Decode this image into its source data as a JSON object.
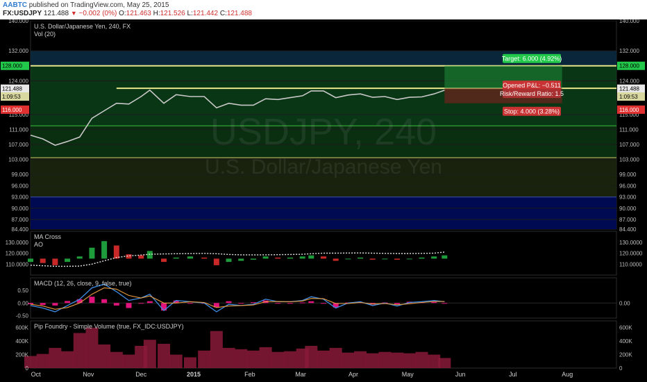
{
  "header": {
    "user": "AABTC",
    "published": "published on TradingView.com, May 25, 2015",
    "symbol": "FX:USDJPY",
    "last": "121.488",
    "change_arrow": "▼",
    "change": "−0.002 (0%)",
    "open_label": "O:",
    "open": "121.463",
    "high_label": "H:",
    "high": "121.526",
    "low_label": "L:",
    "low": "121.442",
    "close_label": "C:",
    "close": "121.488"
  },
  "colors": {
    "background": "#000000",
    "price_line": "#c8c8c8",
    "yellow": "#e8e58a",
    "green_zone": "#0d4d1e",
    "blue_zone": "#000a52",
    "target": "#22c84a",
    "stop": "#c83232",
    "hist_up": "#1e9c3c",
    "hist_down": "#c82828",
    "macd_line": "#3f8ee8",
    "signal_line": "#e89c3f",
    "macd_hist": "#e0147a",
    "volume": "#8a1a3a"
  },
  "chart_data": [
    {
      "type": "line",
      "title": "U.S. Dollar/Japanese Yen, 240, FX",
      "subtitle": "Vol (20)",
      "watermark_symbol": "USDJPY, 240",
      "watermark_name": "U.S. Dollar/Japanese Yen",
      "ylim": [
        84.4,
        140.0
      ],
      "y_ticks": [
        "140.000",
        "132.000",
        "128.000",
        "124.000",
        "121.488",
        "116.000",
        "115.000",
        "111.000",
        "107.000",
        "103.000",
        "99.000",
        "96.000",
        "93.000",
        "90.000",
        "87.000",
        "84.400"
      ],
      "left_price_tags": [
        "128.000",
        "121.488",
        "1:09:53",
        "116.000"
      ],
      "right_price_tags": [
        "128.000",
        "121.488",
        "1:09:53",
        "116.000"
      ],
      "x_ticks": [
        "Oct",
        "Nov",
        "Dec",
        "2015",
        "Feb",
        "Mar",
        "Apr",
        "May",
        "Jun",
        "Jul",
        "Aug"
      ],
      "x": [
        "2014-10-01",
        "2014-10-08",
        "2014-10-15",
        "2014-10-22",
        "2014-10-29",
        "2014-11-05",
        "2014-11-12",
        "2014-11-19",
        "2014-11-26",
        "2014-12-03",
        "2014-12-08",
        "2014-12-16",
        "2014-12-23",
        "2014-12-31",
        "2015-01-08",
        "2015-01-15",
        "2015-01-22",
        "2015-01-29",
        "2015-02-05",
        "2015-02-12",
        "2015-02-19",
        "2015-02-26",
        "2015-03-05",
        "2015-03-10",
        "2015-03-17",
        "2015-03-24",
        "2015-03-31",
        "2015-04-07",
        "2015-04-14",
        "2015-04-21",
        "2015-04-28",
        "2015-05-05",
        "2015-05-12",
        "2015-05-19",
        "2015-05-25"
      ],
      "values": [
        109.5,
        108.5,
        106.8,
        107.8,
        109.0,
        114.0,
        116.0,
        118.0,
        117.8,
        119.8,
        121.5,
        118.0,
        120.3,
        119.8,
        119.8,
        116.8,
        118.0,
        117.5,
        117.5,
        119.2,
        119.0,
        119.5,
        120.0,
        121.3,
        121.3,
        119.5,
        120.2,
        120.5,
        119.6,
        119.8,
        119.0,
        119.6,
        119.7,
        120.5,
        121.488
      ],
      "horizontal_levels": [
        128.0,
        122.0,
        112.0,
        103.5,
        93.0
      ],
      "position": {
        "entry": 122.0,
        "target_price": 128.0,
        "stop_price": 118.0,
        "start": "2015-05-25",
        "end": "2015-07-31",
        "target_label": "Target: 6.000 (4.92%)",
        "pnl_label": "Opened P&L: −0.511",
        "ratio_label": "Risk/Reward Ratio: 1.5",
        "stop_label": "Stop: 4.000 (3.28%)"
      }
    },
    {
      "type": "bar",
      "title": "MA Cross",
      "subtitle": "AO",
      "ylim": [
        100,
        140
      ],
      "y_ticks_left": [
        "130.0000",
        "120.0000",
        "110.0000"
      ],
      "y_ticks_right": [
        "130.0000",
        "120.0000",
        "110.0000"
      ],
      "ma_slow": [
        109.0,
        108.5,
        108.0,
        108.0,
        108.2,
        110.0,
        113.0,
        116.0,
        117.5,
        118.3,
        119.0,
        119.3,
        119.5,
        119.6,
        119.8,
        119.5,
        118.8,
        118.5,
        118.4,
        118.5,
        118.6,
        118.8,
        119.0,
        119.5,
        120.0,
        120.0,
        120.1,
        120.2,
        120.0,
        119.8,
        119.7,
        119.7,
        119.8,
        120.0,
        121.0
      ],
      "ao": [
        -3,
        -4,
        -6,
        -3,
        2,
        10,
        16,
        12,
        4,
        3,
        7,
        -3,
        1,
        2,
        1,
        -6,
        -3,
        -2,
        -1,
        2,
        1,
        1,
        2,
        3,
        2,
        -2,
        0,
        1,
        -1,
        0,
        -1,
        0,
        1,
        2,
        3
      ]
    },
    {
      "type": "line",
      "title": "MACD (12, 26, close, 9, false, true)",
      "ylim": [
        -0.6,
        1.0
      ],
      "y_ticks_left": [
        "0.50",
        "0.00",
        "-0.50"
      ],
      "y_ticks_right": [
        "0.00"
      ],
      "macd": [
        -0.1,
        -0.2,
        -0.35,
        -0.1,
        0.15,
        0.6,
        0.75,
        0.45,
        0.1,
        0.2,
        0.35,
        -0.3,
        0.1,
        0.05,
        0.0,
        -0.35,
        -0.05,
        -0.1,
        -0.05,
        0.15,
        0.05,
        0.05,
        0.1,
        0.25,
        0.15,
        -0.2,
        0.0,
        0.05,
        -0.1,
        0.0,
        -0.12,
        0.02,
        0.05,
        0.1,
        0.05
      ],
      "signal": [
        -0.05,
        -0.12,
        -0.25,
        -0.18,
        0.0,
        0.35,
        0.6,
        0.55,
        0.3,
        0.2,
        0.28,
        0.0,
        0.0,
        0.05,
        0.02,
        -0.18,
        -0.12,
        -0.1,
        -0.08,
        0.05,
        0.06,
        0.05,
        0.08,
        0.18,
        0.17,
        -0.02,
        -0.02,
        0.02,
        -0.04,
        -0.02,
        -0.07,
        -0.03,
        0.02,
        0.06,
        0.06
      ]
    },
    {
      "type": "bar",
      "title": "Pip Foundry - Simple Volume (true, FX_IDC:USDJPY)",
      "ylim": [
        0,
        700000
      ],
      "y_ticks_left": [
        "600K",
        "400K",
        "200K",
        "0"
      ],
      "y_ticks_right": [
        "600K",
        "400K",
        "200K",
        "0"
      ],
      "values": [
        180000,
        210000,
        300000,
        250000,
        520000,
        600000,
        350000,
        240000,
        200000,
        330000,
        420000,
        360000,
        200000,
        160000,
        260000,
        550000,
        300000,
        280000,
        260000,
        310000,
        240000,
        250000,
        290000,
        330000,
        260000,
        300000,
        230000,
        250000,
        220000,
        240000,
        230000,
        220000,
        240000,
        200000,
        150000
      ]
    }
  ]
}
